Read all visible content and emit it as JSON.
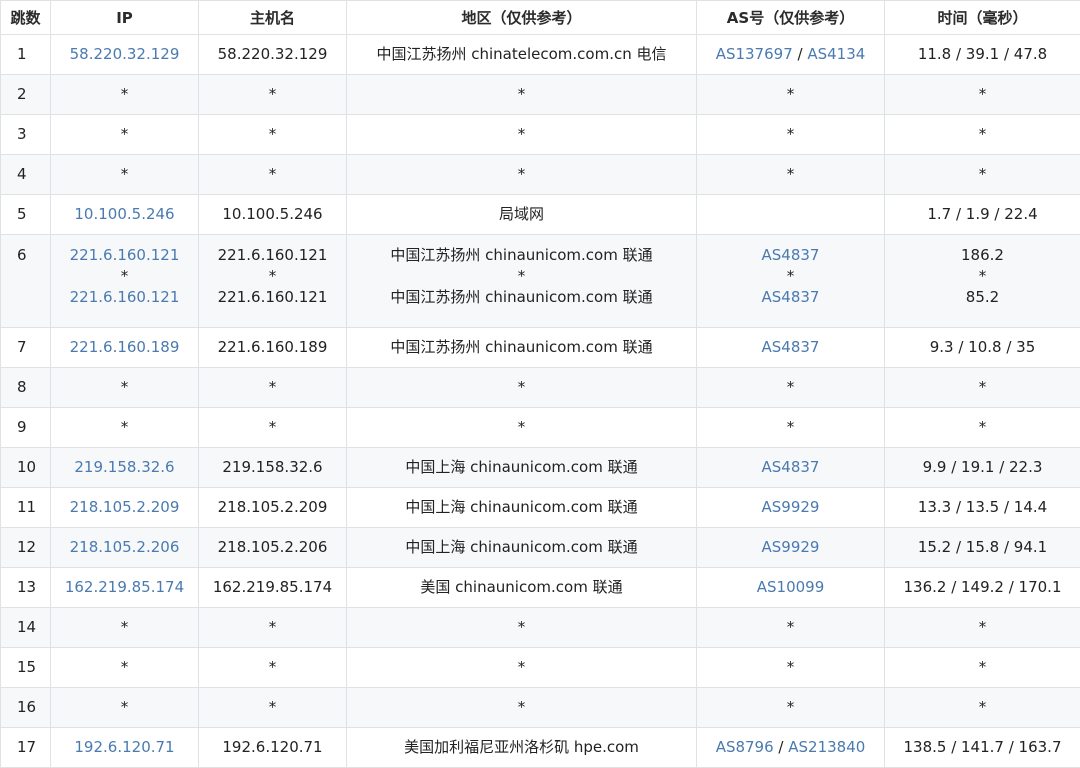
{
  "headers": [
    "跳数",
    "IP",
    "主机名",
    "地区（仅供参考）",
    "AS号（仅供参考）",
    "时间（毫秒）"
  ],
  "rows": [
    {
      "hop": "1",
      "ip": [
        "58.220.32.129"
      ],
      "host": [
        "58.220.32.129"
      ],
      "region": [
        "中国江苏扬州 chinatelecom.com.cn 电信"
      ],
      "as": [
        [
          "AS137697",
          "AS4134"
        ]
      ],
      "time": [
        "11.8 / 39.1 / 47.8"
      ]
    },
    {
      "hop": "2",
      "ip": [
        "*"
      ],
      "host": [
        "*"
      ],
      "region": [
        "*"
      ],
      "as": [
        [
          "*"
        ]
      ],
      "time": [
        "*"
      ]
    },
    {
      "hop": "3",
      "ip": [
        "*"
      ],
      "host": [
        "*"
      ],
      "region": [
        "*"
      ],
      "as": [
        [
          "*"
        ]
      ],
      "time": [
        "*"
      ]
    },
    {
      "hop": "4",
      "ip": [
        "*"
      ],
      "host": [
        "*"
      ],
      "region": [
        "*"
      ],
      "as": [
        [
          "*"
        ]
      ],
      "time": [
        "*"
      ]
    },
    {
      "hop": "5",
      "ip": [
        "10.100.5.246"
      ],
      "host": [
        "10.100.5.246"
      ],
      "region": [
        "局域网"
      ],
      "as": [
        []
      ],
      "time": [
        "1.7 / 1.9 / 22.4"
      ]
    },
    {
      "hop": "6",
      "ip": [
        "221.6.160.121",
        "*",
        "221.6.160.121"
      ],
      "host": [
        "221.6.160.121",
        "*",
        "221.6.160.121"
      ],
      "region": [
        "中国江苏扬州 chinaunicom.com 联通",
        "*",
        "中国江苏扬州 chinaunicom.com 联通"
      ],
      "as": [
        [
          "AS4837"
        ],
        [
          "*"
        ],
        [
          "AS4837"
        ]
      ],
      "time": [
        "186.2",
        "*",
        "85.2"
      ]
    },
    {
      "hop": "7",
      "ip": [
        "221.6.160.189"
      ],
      "host": [
        "221.6.160.189"
      ],
      "region": [
        "中国江苏扬州 chinaunicom.com 联通"
      ],
      "as": [
        [
          "AS4837"
        ]
      ],
      "time": [
        "9.3 / 10.8 / 35"
      ]
    },
    {
      "hop": "8",
      "ip": [
        "*"
      ],
      "host": [
        "*"
      ],
      "region": [
        "*"
      ],
      "as": [
        [
          "*"
        ]
      ],
      "time": [
        "*"
      ]
    },
    {
      "hop": "9",
      "ip": [
        "*"
      ],
      "host": [
        "*"
      ],
      "region": [
        "*"
      ],
      "as": [
        [
          "*"
        ]
      ],
      "time": [
        "*"
      ]
    },
    {
      "hop": "10",
      "ip": [
        "219.158.32.6"
      ],
      "host": [
        "219.158.32.6"
      ],
      "region": [
        "中国上海 chinaunicom.com 联通"
      ],
      "as": [
        [
          "AS4837"
        ]
      ],
      "time": [
        "9.9 / 19.1 / 22.3"
      ]
    },
    {
      "hop": "11",
      "ip": [
        "218.105.2.209"
      ],
      "host": [
        "218.105.2.209"
      ],
      "region": [
        "中国上海 chinaunicom.com 联通"
      ],
      "as": [
        [
          "AS9929"
        ]
      ],
      "time": [
        "13.3 / 13.5 / 14.4"
      ]
    },
    {
      "hop": "12",
      "ip": [
        "218.105.2.206"
      ],
      "host": [
        "218.105.2.206"
      ],
      "region": [
        "中国上海 chinaunicom.com 联通"
      ],
      "as": [
        [
          "AS9929"
        ]
      ],
      "time": [
        "15.2 / 15.8 / 94.1"
      ]
    },
    {
      "hop": "13",
      "ip": [
        "162.219.85.174"
      ],
      "host": [
        "162.219.85.174"
      ],
      "region": [
        "美国 chinaunicom.com 联通"
      ],
      "as": [
        [
          "AS10099"
        ]
      ],
      "time": [
        "136.2 / 149.2 / 170.1"
      ]
    },
    {
      "hop": "14",
      "ip": [
        "*"
      ],
      "host": [
        "*"
      ],
      "region": [
        "*"
      ],
      "as": [
        [
          "*"
        ]
      ],
      "time": [
        "*"
      ]
    },
    {
      "hop": "15",
      "ip": [
        "*"
      ],
      "host": [
        "*"
      ],
      "region": [
        "*"
      ],
      "as": [
        [
          "*"
        ]
      ],
      "time": [
        "*"
      ]
    },
    {
      "hop": "16",
      "ip": [
        "*"
      ],
      "host": [
        "*"
      ],
      "region": [
        "*"
      ],
      "as": [
        [
          "*"
        ]
      ],
      "time": [
        "*"
      ]
    },
    {
      "hop": "17",
      "ip": [
        "192.6.120.71"
      ],
      "host": [
        "192.6.120.71"
      ],
      "region": [
        "美国加利福尼亚州洛杉矶 hpe.com"
      ],
      "as": [
        [
          "AS8796",
          "AS213840"
        ]
      ],
      "time": [
        "138.5 / 141.7 / 163.7"
      ]
    }
  ],
  "colors": {
    "link": "#4a7ab0",
    "border": "#dfe2e5",
    "stripe": "#f6f8fa"
  }
}
